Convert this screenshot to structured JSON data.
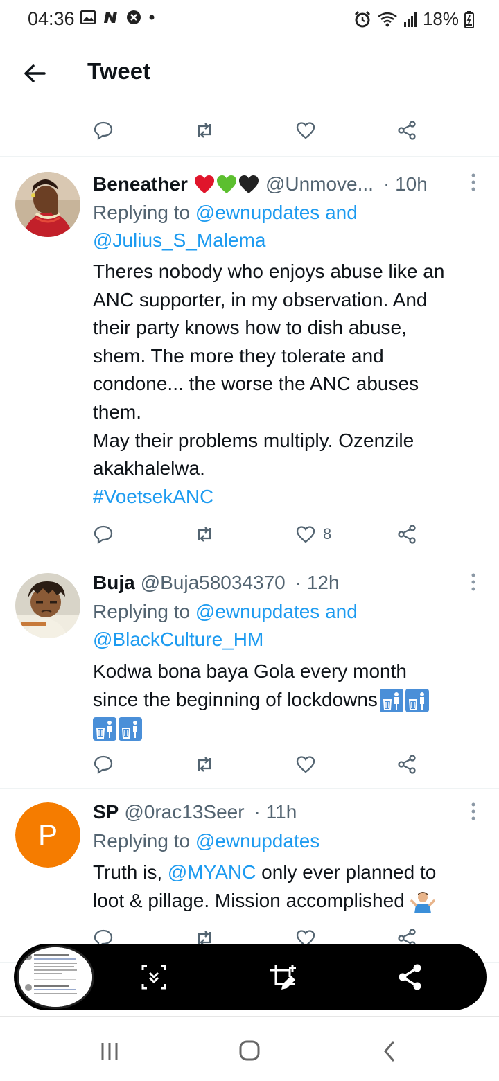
{
  "status_bar": {
    "time": "04:36",
    "battery": "18%",
    "left_icons": [
      "gallery-icon",
      "n-app-icon",
      "blocked-icon",
      "dot-icon"
    ],
    "right_icons": [
      "alarm-icon",
      "wifi-icon",
      "signal-icon",
      "battery-icon"
    ]
  },
  "header": {
    "title": "Tweet"
  },
  "tweets": [
    {
      "name": "Beneather",
      "emoji": [
        "red-heart",
        "green-heart",
        "black-heart"
      ],
      "handle": "@Unmove...",
      "time": "· 10h",
      "replying_prefix": "Replying to ",
      "replying_1": "@ewnupdates and",
      "replying_2": "@Julius_S_Malema",
      "lines": [
        "Theres nobody who enjoys abuse like an",
        "ANC supporter,  in my observation. And",
        "their party knows how to dish abuse,",
        "shem. The more they tolerate and",
        "condone... the worse the ANC abuses",
        "them.",
        "May their problems multiply. Ozenzile",
        "akakhalelwa."
      ],
      "hashtag": "#VoetsekANC",
      "likes": "8"
    },
    {
      "name": "Buja",
      "handle": "@Buja58034370",
      "time": "· 12h",
      "replying_prefix": "Replying to ",
      "replying_1": "@ewnupdates and",
      "replying_2": "@BlackCulture_HM",
      "lines": [
        "Kodwa bona baya Gola every month",
        "since the beginning of lockdowns"
      ],
      "emoji": [
        "litter-in-bin",
        "litter-in-bin",
        "litter-in-bin",
        "litter-in-bin"
      ]
    },
    {
      "name": "SP",
      "handle": "@0rac13Seer",
      "time": "· 11h",
      "avatar_letter": "P",
      "avatar_color": "#f57c00",
      "replying_prefix": "Replying to ",
      "replying_1": "@ewnupdates",
      "body_prefix": "Truth is, ",
      "mention": "@MYANC",
      "body_rest": " only ever planned to",
      "line2": "loot & pillage. Mission accomplished",
      "emoji": [
        "man-shrugging"
      ]
    }
  ],
  "toolbar": {
    "buttons": [
      "scroll-capture-icon",
      "crop-edit-icon",
      "share-icon"
    ]
  },
  "nav_bar": {
    "buttons": [
      "recent-apps-icon",
      "home-icon",
      "back-icon"
    ]
  },
  "colors": {
    "accent": "#1d9bf0",
    "secondary_text": "#536471",
    "divider": "#eff3f4",
    "avatar_sp": "#f57c00"
  }
}
